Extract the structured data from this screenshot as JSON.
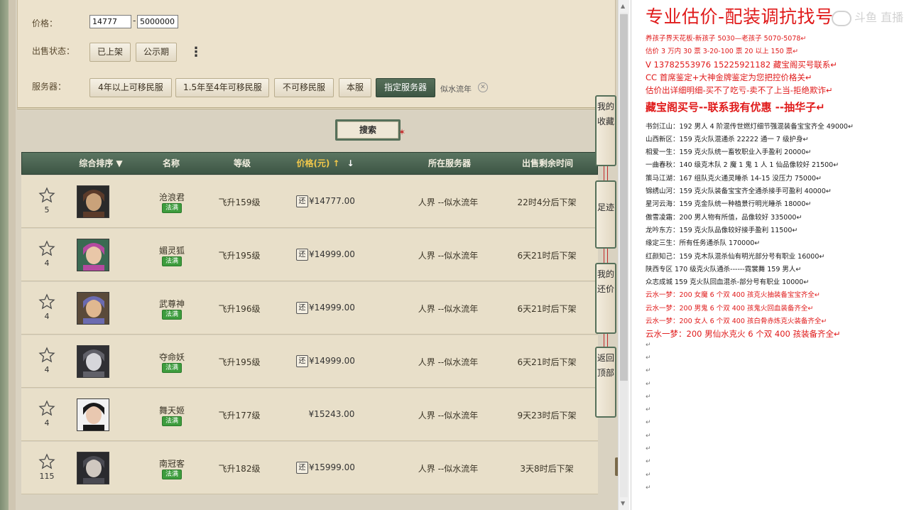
{
  "filter": {
    "price_label": "价格：",
    "price_min": "14777",
    "price_sep": "-",
    "price_max": "5000000",
    "sale_status_label": "出售状态：",
    "sale_status_options": [
      "已上架",
      "公示期"
    ],
    "more_symbol": "⋮",
    "server_label": "服务器：",
    "server_options": [
      "4年以上可移民服",
      "1.5年至4年可移民服",
      "不可移民服",
      "本服",
      "指定服务器"
    ],
    "selected_server": "似水流年",
    "clear_symbol": "✕"
  },
  "search": {
    "label": "搜索"
  },
  "table": {
    "headers": {
      "sort": "综合排序",
      "name": "名称",
      "level": "等级",
      "price": "价格(元)",
      "server": "所在服务器",
      "time": "出售剩余时间"
    },
    "sort_arrow": "▼",
    "price_up": "↑",
    "price_down": "↓",
    "bargain_glyph": "还",
    "rows": [
      {
        "fav": "5",
        "name": "沧浪君",
        "sect": "法满",
        "level": "飞升159级",
        "bargain": true,
        "price": "¥14777.00",
        "server": "人界 --似水流年",
        "time": "22时4分后下架"
      },
      {
        "fav": "4",
        "name": "媚灵狐",
        "sect": "法满",
        "level": "飞升195级",
        "bargain": true,
        "price": "¥14999.00",
        "server": "人界 --似水流年",
        "time": "6天21时后下架"
      },
      {
        "fav": "4",
        "name": "武尊神",
        "sect": "法满",
        "level": "飞升196级",
        "bargain": true,
        "price": "¥14999.00",
        "server": "人界 --似水流年",
        "time": "6天21时后下架"
      },
      {
        "fav": "4",
        "name": "夺命妖",
        "sect": "法满",
        "level": "飞升195级",
        "bargain": true,
        "price": "¥14999.00",
        "server": "人界 --似水流年",
        "time": "6天21时后下架"
      },
      {
        "fav": "4",
        "name": "舞天姬",
        "sect": "法满",
        "level": "飞升177级",
        "bargain": false,
        "price": "¥15243.00",
        "server": "人界 --似水流年",
        "time": "9天23时后下架"
      },
      {
        "fav": "115",
        "name": "南冠客",
        "sect": "法满",
        "level": "飞升182级",
        "bargain": true,
        "price": "¥15999.00",
        "server": "人界 --似水流年",
        "time": "3天8时后下架"
      }
    ]
  },
  "side_buttons": [
    "我的收藏",
    "足迹",
    "我的还价",
    "返回顶部"
  ],
  "notes": {
    "title": "专业估价-配装调抗找号",
    "watermark": "斗鱼 直播",
    "lines": [
      {
        "t": "养孩子界天花板-新孩子 5030—老孩子 5070-5078↵",
        "c": "red"
      },
      {
        "t": "估价 3 万内 30 票      3-20-100 票        20 以上 150 票↵",
        "c": "red"
      },
      {
        "t": "V 13782553976     15225921182   藏宝阁买号联系↵",
        "c": "red",
        "s": "m"
      },
      {
        "t": "CC 首席鉴定+大神金牌鉴定为您把控价格关↵",
        "c": "red",
        "s": "m"
      },
      {
        "t": "估价出详细明细-买不了吃亏-卖不了上当-拒绝欺诈↵",
        "c": "red",
        "s": "m"
      },
      {
        "t": "藏宝阁买号--联系我有优惠 --抽华子↵",
        "c": "bold"
      },
      {
        "t": "书剑江山：192 男人 4 阶混传世燃灯细节强混装备宝宝齐全 49000↵",
        "c": "black"
      },
      {
        "t": "山西新区：159 克火队混通杀 22222 通一 7 级护身↵",
        "c": "black"
      },
      {
        "t": "相爱一生：159 克火队统一畜牧职业入手盈利 20000↵",
        "c": "black"
      },
      {
        "t": "一曲春秋：140 级克木队 2 魔 1 鬼 1 人 1 仙品像较好 21500↵",
        "c": "black"
      },
      {
        "t": "策马江湖：167 组队克火通灵睡杀 14-15 没压力 75000↵",
        "c": "black"
      },
      {
        "t": "锦绣山河：159 克火队装备宝宝齐全通杀接手可盈利 40000↵",
        "c": "black"
      },
      {
        "t": "星河云海：159 克金队统一种植景行明光睡杀 18000↵",
        "c": "black"
      },
      {
        "t": "傲雪凌霜：200 男人物有所值，品像较好 335000↵",
        "c": "black"
      },
      {
        "t": "龙吟东方：159 克火队品像较好接手盈利 11500↵",
        "c": "black"
      },
      {
        "t": "缘定三生：所有任务通杀队 170000↵",
        "c": "black"
      },
      {
        "t": "红颜知己：159 克木队混杀仙有明光部分号有职业 16000↵",
        "c": "black"
      },
      {
        "t": "陕西专区 170 级克火队通杀------霓裳舞 159 男人↵",
        "c": "black"
      },
      {
        "t": "众志成城 159 克火队回血混杀-部分号有职业 10000↵",
        "c": "black"
      },
      {
        "t": "云水一梦：200 女魔 6 个双 400 孩克火抽装备宝宝齐全↵",
        "c": "red"
      },
      {
        "t": "云水一梦：200 男鬼 6 个双 400 孩鬼火回血装备齐全↵",
        "c": "red"
      },
      {
        "t": "云水一梦：200 女人 6 个双 400 孩白骨赤炼克火装备齐全↵",
        "c": "red"
      },
      {
        "t": "云水一梦：200 男仙水克火 6 个双 400 孩装备齐全↵",
        "c": "red",
        "s": "m"
      }
    ],
    "empty_marker": "↵",
    "empty_count": 12
  }
}
